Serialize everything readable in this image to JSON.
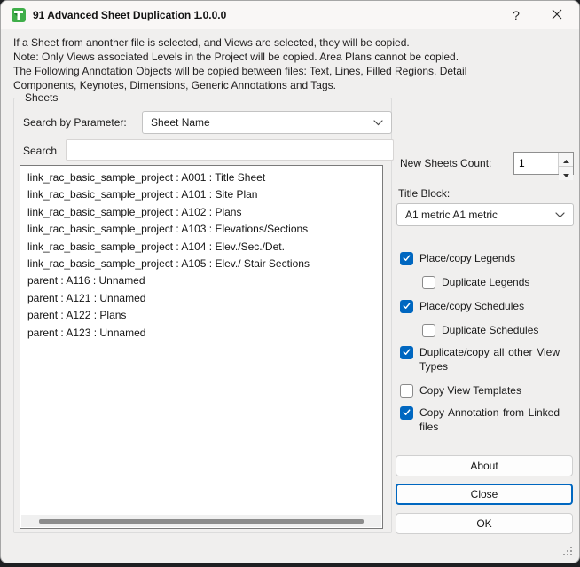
{
  "window": {
    "title": "91 Advanced Sheet Duplication 1.0.0.0",
    "help_button": "?"
  },
  "warning_lines": [
    "If a Sheet from anonther file is selected, and Views are selected, they will be copied.",
    "Note: Only Views associated Levels in the Project will be copied. Area Plans cannot be copied.",
    "The Following Annotation Objects will be copied between files: Text, Lines, Filled Regions, Detail",
    "Components, Keynotes, Dimensions, Generic Annotations and Tags."
  ],
  "sheets_group": {
    "title": "Sheets",
    "search_by_parameter_label": "Search by Parameter:",
    "parameter_value": "Sheet Name",
    "search_label": "Search",
    "search_value": "",
    "sheet_list": [
      "link_rac_basic_sample_project : A001 : Title Sheet",
      "link_rac_basic_sample_project : A101 : Site Plan",
      "link_rac_basic_sample_project : A102 : Plans",
      "link_rac_basic_sample_project : A103 : Elevations/Sections",
      "link_rac_basic_sample_project : A104 : Elev./Sec./Det.",
      "link_rac_basic_sample_project : A105 : Elev./ Stair Sections",
      "parent : A116 : Unnamed",
      "parent : A121 : Unnamed",
      "parent : A122 : Plans",
      "parent : A123 : Unnamed"
    ]
  },
  "options": {
    "new_sheets_count_label": "New Sheets Count:",
    "new_sheets_count_value": "1",
    "title_block_label": "Title Block:",
    "title_block_value": "A1 metric A1 metric",
    "checkboxes": [
      {
        "label": "Place/copy Legends",
        "checked": true,
        "indent": false,
        "wrap": false
      },
      {
        "label": "Duplicate Legends",
        "checked": false,
        "indent": true,
        "wrap": false
      },
      {
        "label": "Place/copy Schedules",
        "checked": true,
        "indent": false,
        "wrap": false
      },
      {
        "label": "Duplicate Schedules",
        "checked": false,
        "indent": true,
        "wrap": false
      },
      {
        "label": "Duplicate/copy all other View Types",
        "checked": true,
        "indent": false,
        "wrap": true
      },
      {
        "label": "Copy View Templates",
        "checked": false,
        "indent": false,
        "wrap": false
      },
      {
        "label": "Copy Annotation from Linked files",
        "checked": true,
        "indent": false,
        "wrap": true
      }
    ]
  },
  "buttons": {
    "about": "About",
    "close": "Close",
    "ok": "OK"
  },
  "colors": {
    "accent": "#0067c0",
    "icon_green": "#3fae49",
    "window_bg": "#f0efee",
    "titlebar_bg": "#f9f7f6"
  }
}
